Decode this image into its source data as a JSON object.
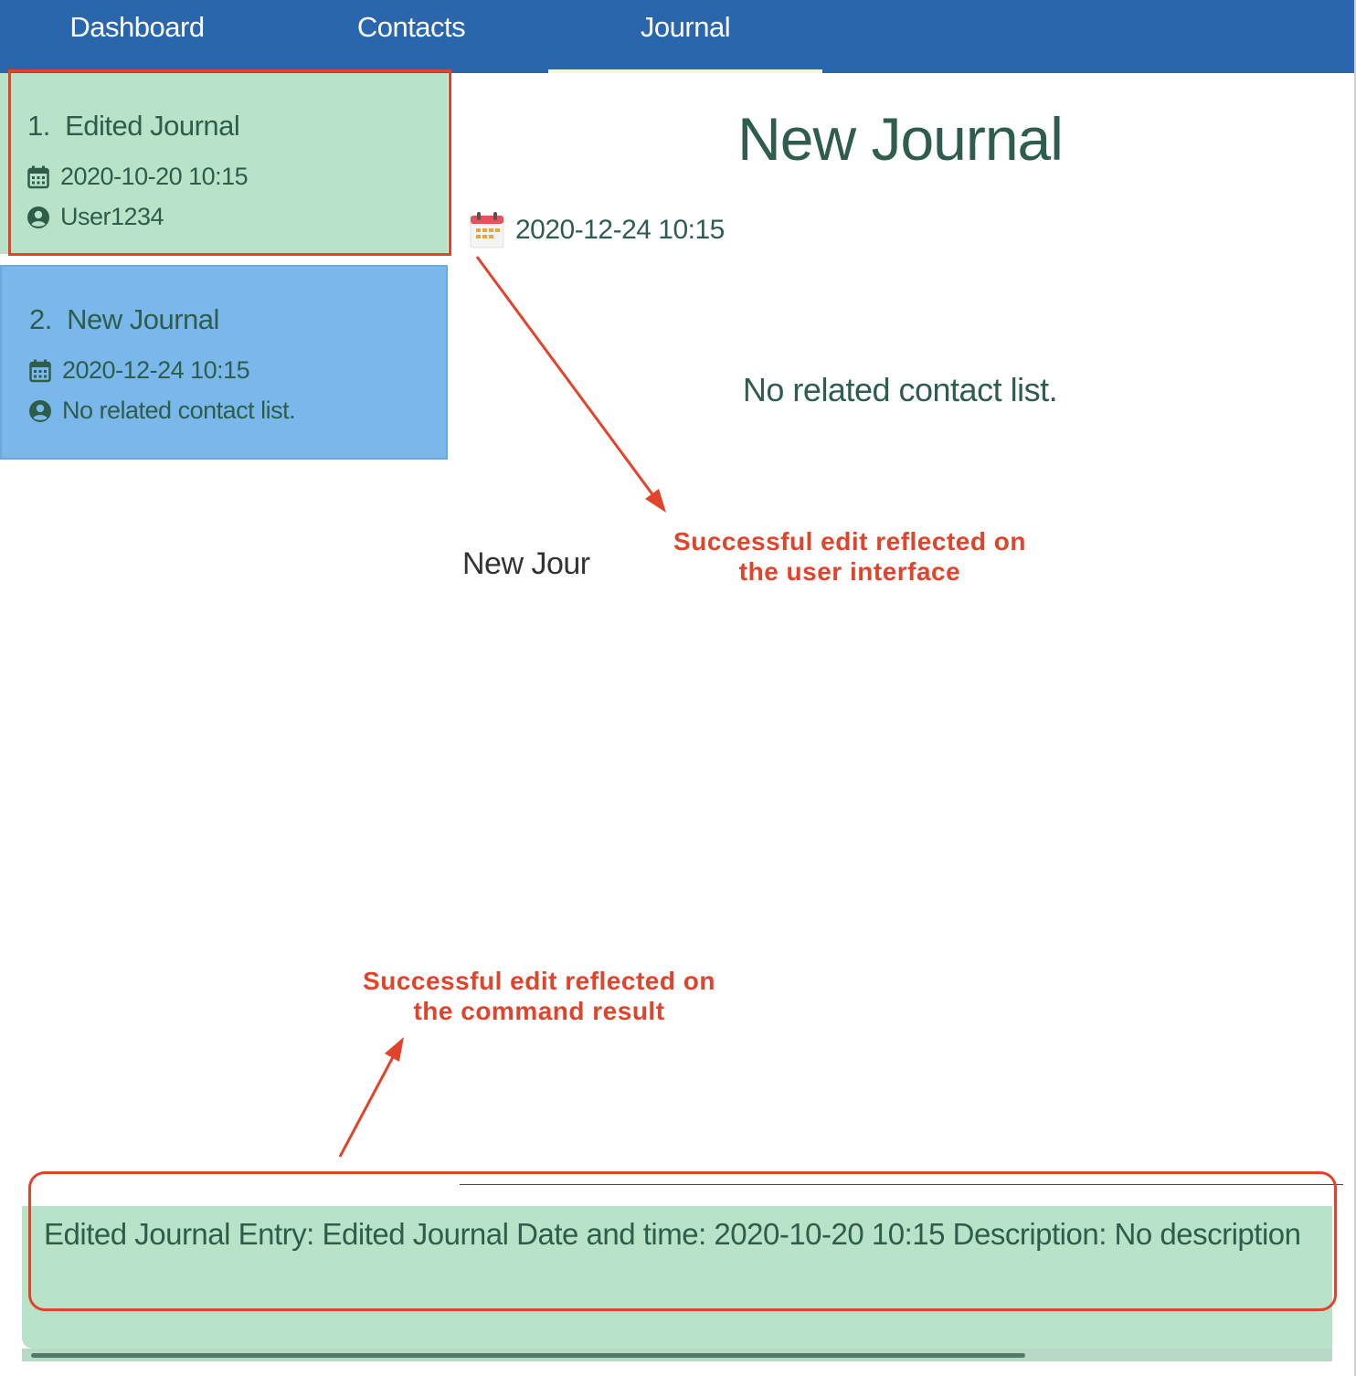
{
  "nav": {
    "tabs": [
      {
        "label": "Dashboard"
      },
      {
        "label": "Contacts"
      },
      {
        "label": "Journal"
      }
    ]
  },
  "journal_list": [
    {
      "index": "1.",
      "title": "Edited Journal",
      "datetime": "2020-10-20 10:15",
      "contact": "User1234"
    },
    {
      "index": "2.",
      "title": "New Journal",
      "datetime": "2020-12-24 10:15",
      "contact": "No related contact list."
    }
  ],
  "detail": {
    "title": "New Journal",
    "datetime": "2020-12-24 10:15",
    "contacts": "No related contact list.",
    "description_clipped": "New Jour"
  },
  "result": {
    "text": "Edited Journal Entry: Edited Journal Date and time: 2020-10-20 10:15 Description: No description"
  },
  "annotations": {
    "ui_note": "Successful edit reflected on the user interface",
    "ui_note_line1": "Successful edit reflected on",
    "ui_note_line2": "the user interface",
    "result_note_line1": "Successful edit reflected on",
    "result_note_line2": "the command result"
  },
  "colors": {
    "nav_bg": "#2a66ad",
    "card_green": "#b8e3c8",
    "card_selected": "#7ab8ec",
    "text_green": "#2e5d4b",
    "annotation_red": "#e2432b"
  },
  "icons": [
    "calendar-icon",
    "user-icon"
  ]
}
